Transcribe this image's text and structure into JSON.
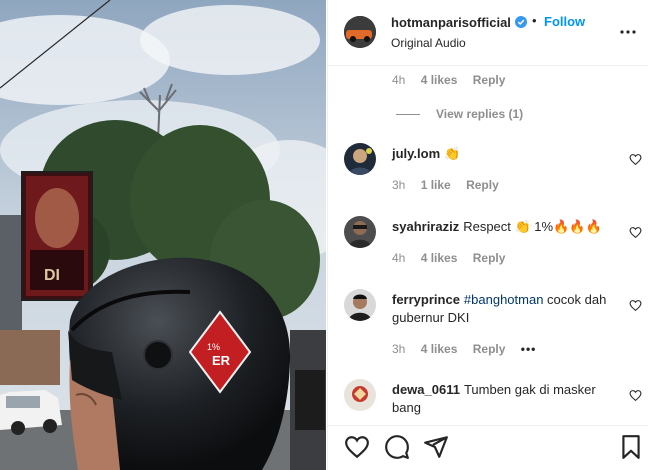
{
  "post": {
    "username": "hotmanparisofficial",
    "follow_label": "Follow",
    "separator": "•",
    "audio": "Original Audio"
  },
  "media": {
    "billboard_text": "DI"
  },
  "comments_top": {
    "time": "4h",
    "likes": "4 likes",
    "reply": "Reply",
    "view_replies": "View replies (1)"
  },
  "comments": [
    {
      "user": "july.lom",
      "text": "👏",
      "time": "3h",
      "likes": "1 like",
      "reply": "Reply"
    },
    {
      "user": "syahriraziz",
      "text": "Respect 👏 1%🔥🔥🔥",
      "time": "4h",
      "likes": "4 likes",
      "reply": "Reply"
    },
    {
      "user": "ferryprince",
      "hashtag": "#banghotman",
      "text": " cocok dah gubernur DKI",
      "time": "3h",
      "likes": "4 likes",
      "reply": "Reply",
      "more": "•••"
    },
    {
      "user": "dewa_0611",
      "text": "Tumben gak di masker bang"
    }
  ],
  "icons": {
    "like": "heart-icon",
    "comment": "comment-icon",
    "share": "share-icon",
    "save": "bookmark-icon",
    "more": "more-icon",
    "verified": "verified-badge-icon"
  },
  "colors": {
    "accent": "#0095f6",
    "secondary_text": "#8e8e8e",
    "hashtag": "#00376b"
  }
}
